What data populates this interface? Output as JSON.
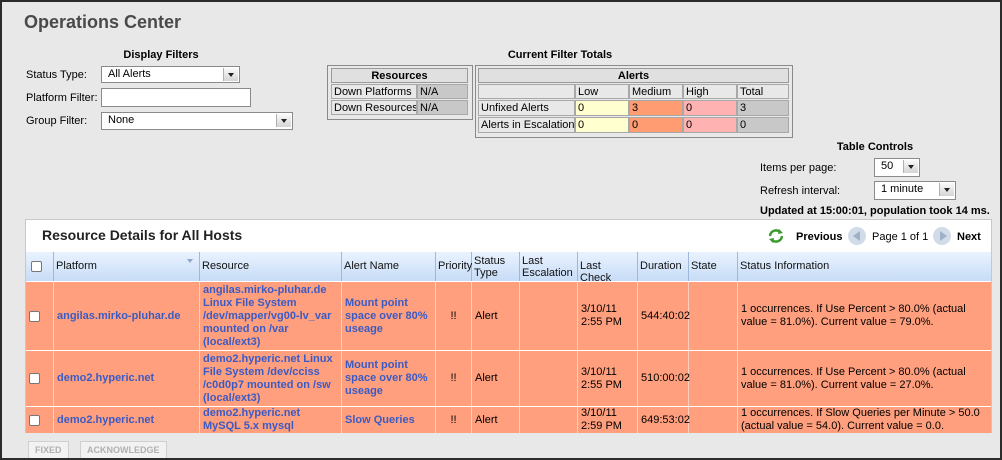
{
  "title": "Operations Center",
  "display_filters": {
    "heading": "Display Filters",
    "status_type_label": "Status Type:",
    "status_type_value": "All Alerts",
    "platform_filter_label": "Platform Filter:",
    "platform_filter_value": "",
    "group_filter_label": "Group Filter:",
    "group_filter_value": "None"
  },
  "filter_totals": {
    "heading": "Current Filter Totals",
    "resources_heading": "Resources",
    "resources": [
      {
        "label": "Down Platforms",
        "value": "N/A"
      },
      {
        "label": "Down Resources",
        "value": "N/A"
      }
    ],
    "alerts_heading": "Alerts",
    "alert_columns": [
      "Low",
      "Medium",
      "High",
      "Total"
    ],
    "alert_rows": [
      {
        "label": "Unfixed Alerts",
        "values": [
          "0",
          "3",
          "0",
          "3"
        ]
      },
      {
        "label": "Alerts in Escalation",
        "values": [
          "0",
          "0",
          "0",
          "0"
        ]
      }
    ]
  },
  "table_controls": {
    "heading": "Table Controls",
    "items_per_page_label": "Items per page:",
    "items_per_page_value": "50",
    "refresh_interval_label": "Refresh interval:",
    "refresh_interval_value": "1 minute",
    "updated_text": "Updated at 15:00:01, population took 14 ms."
  },
  "details": {
    "title": "Resource Details for All Hosts",
    "pager": {
      "previous": "Previous",
      "page_text": "Page 1 of 1",
      "next": "Next"
    },
    "columns": [
      "Platform",
      "Resource",
      "Alert Name",
      "Priority",
      "Status Type",
      "Last Escalation",
      "Last Check",
      "Duration",
      "State",
      "Status Information"
    ],
    "rows": [
      {
        "platform": "angilas.mirko-pluhar.de",
        "resource": "angilas.mirko-pluhar.de Linux File System /dev/mapper/vg00-lv_var mounted on /var (local/ext3)",
        "alert_name": "Mount point space over 80% useage",
        "priority": "!!",
        "status_type": "Alert",
        "last_escalation": "",
        "last_check": "3/10/11 2:55 PM",
        "duration": "544:40:02",
        "state": "",
        "status_info": "1 occurrences. If Use Percent > 80.0% (actual value = 81.0%). Current value = 79.0%."
      },
      {
        "platform": "demo2.hyperic.net",
        "resource": "demo2.hyperic.net Linux File System /dev/cciss /c0d0p7 mounted on /sw (local/ext3)",
        "alert_name": "Mount point space over 80% useage",
        "priority": "!!",
        "status_type": "Alert",
        "last_escalation": "",
        "last_check": "3/10/11 2:55 PM",
        "duration": "510:00:02",
        "state": "",
        "status_info": "1 occurrences. If Use Percent > 80.0% (actual value = 81.0%). Current value = 27.0%."
      },
      {
        "platform": "demo2.hyperic.net",
        "resource": "demo2.hyperic.net MySQL 5.x mysql",
        "alert_name": "Slow Queries",
        "priority": "!!",
        "status_type": "Alert",
        "last_escalation": "",
        "last_check": "3/10/11 2:59 PM",
        "duration": "649:53:02",
        "state": "",
        "status_info": "1 occurrences. If Slow Queries per Minute > 50.0 (actual value = 54.0). Current value = 0.0."
      }
    ]
  },
  "actions": {
    "fixed": "FIXED",
    "acknowledge": "ACKNOWLEDGE"
  },
  "colors": {
    "medium": "#ff9c72",
    "high": "#ffb2b2",
    "low": "#ffffd0",
    "row": "#ff9f7d",
    "link": "#3b5bc4"
  }
}
